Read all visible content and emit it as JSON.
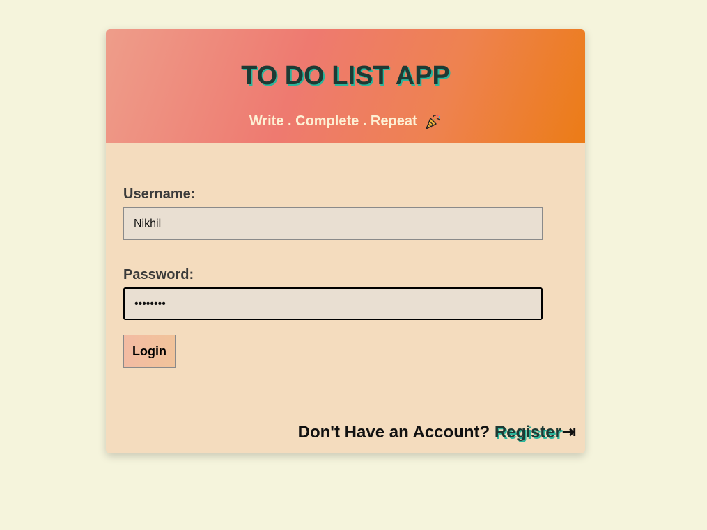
{
  "header": {
    "title": "TO DO LIST APP",
    "tagline": "Write . Complete . Repeat"
  },
  "form": {
    "username_label": "Username:",
    "username_value": "Nikhil",
    "password_label": "Password:",
    "password_value": "••••••••",
    "login_label": "Login"
  },
  "footer": {
    "prompt": "Don't Have an Account?",
    "register_label": "Register",
    "register_icon": "arrow-right-to-bar-icon"
  },
  "colors": {
    "page_background": "#f5f4dc",
    "card_background": "#f4dcbe",
    "title_color": "#1e3a34",
    "title_shadow": "#2bb59b",
    "header_gradient_start": "#ee9d8a",
    "header_gradient_end": "#ec7c16"
  }
}
